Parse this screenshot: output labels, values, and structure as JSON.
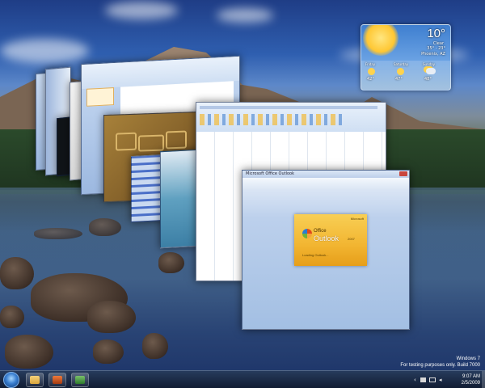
{
  "weather": {
    "temperature": "10°",
    "condition": "Clear",
    "range": "35° - 23°",
    "location": "Phoenix, AZ",
    "forecast": [
      {
        "day": "Friday",
        "temp": "42°"
      },
      {
        "day": "Saturday",
        "temp": "47°"
      },
      {
        "day": "Sunday",
        "temp": "48°"
      }
    ]
  },
  "outlook_window": {
    "title": "Microsoft Office Outlook",
    "splash_brand_small": "Microsoft",
    "splash_brand_office": "Office",
    "splash_brand_product": "Outlook",
    "splash_year": "2007",
    "splash_status": "Loading Outlook..."
  },
  "watermark": {
    "line1": "Windows 7",
    "line2": "For testing purposes only. Build 7000",
    "time": "9:07 AM",
    "date": "2/5/2009"
  },
  "taskbar": {
    "buttons": [
      "folder-icon",
      "media-icon",
      "spreadsheet-icon"
    ]
  },
  "colors": {
    "accent": "#3a7fd0",
    "outlook_splash": "#f2b531"
  }
}
